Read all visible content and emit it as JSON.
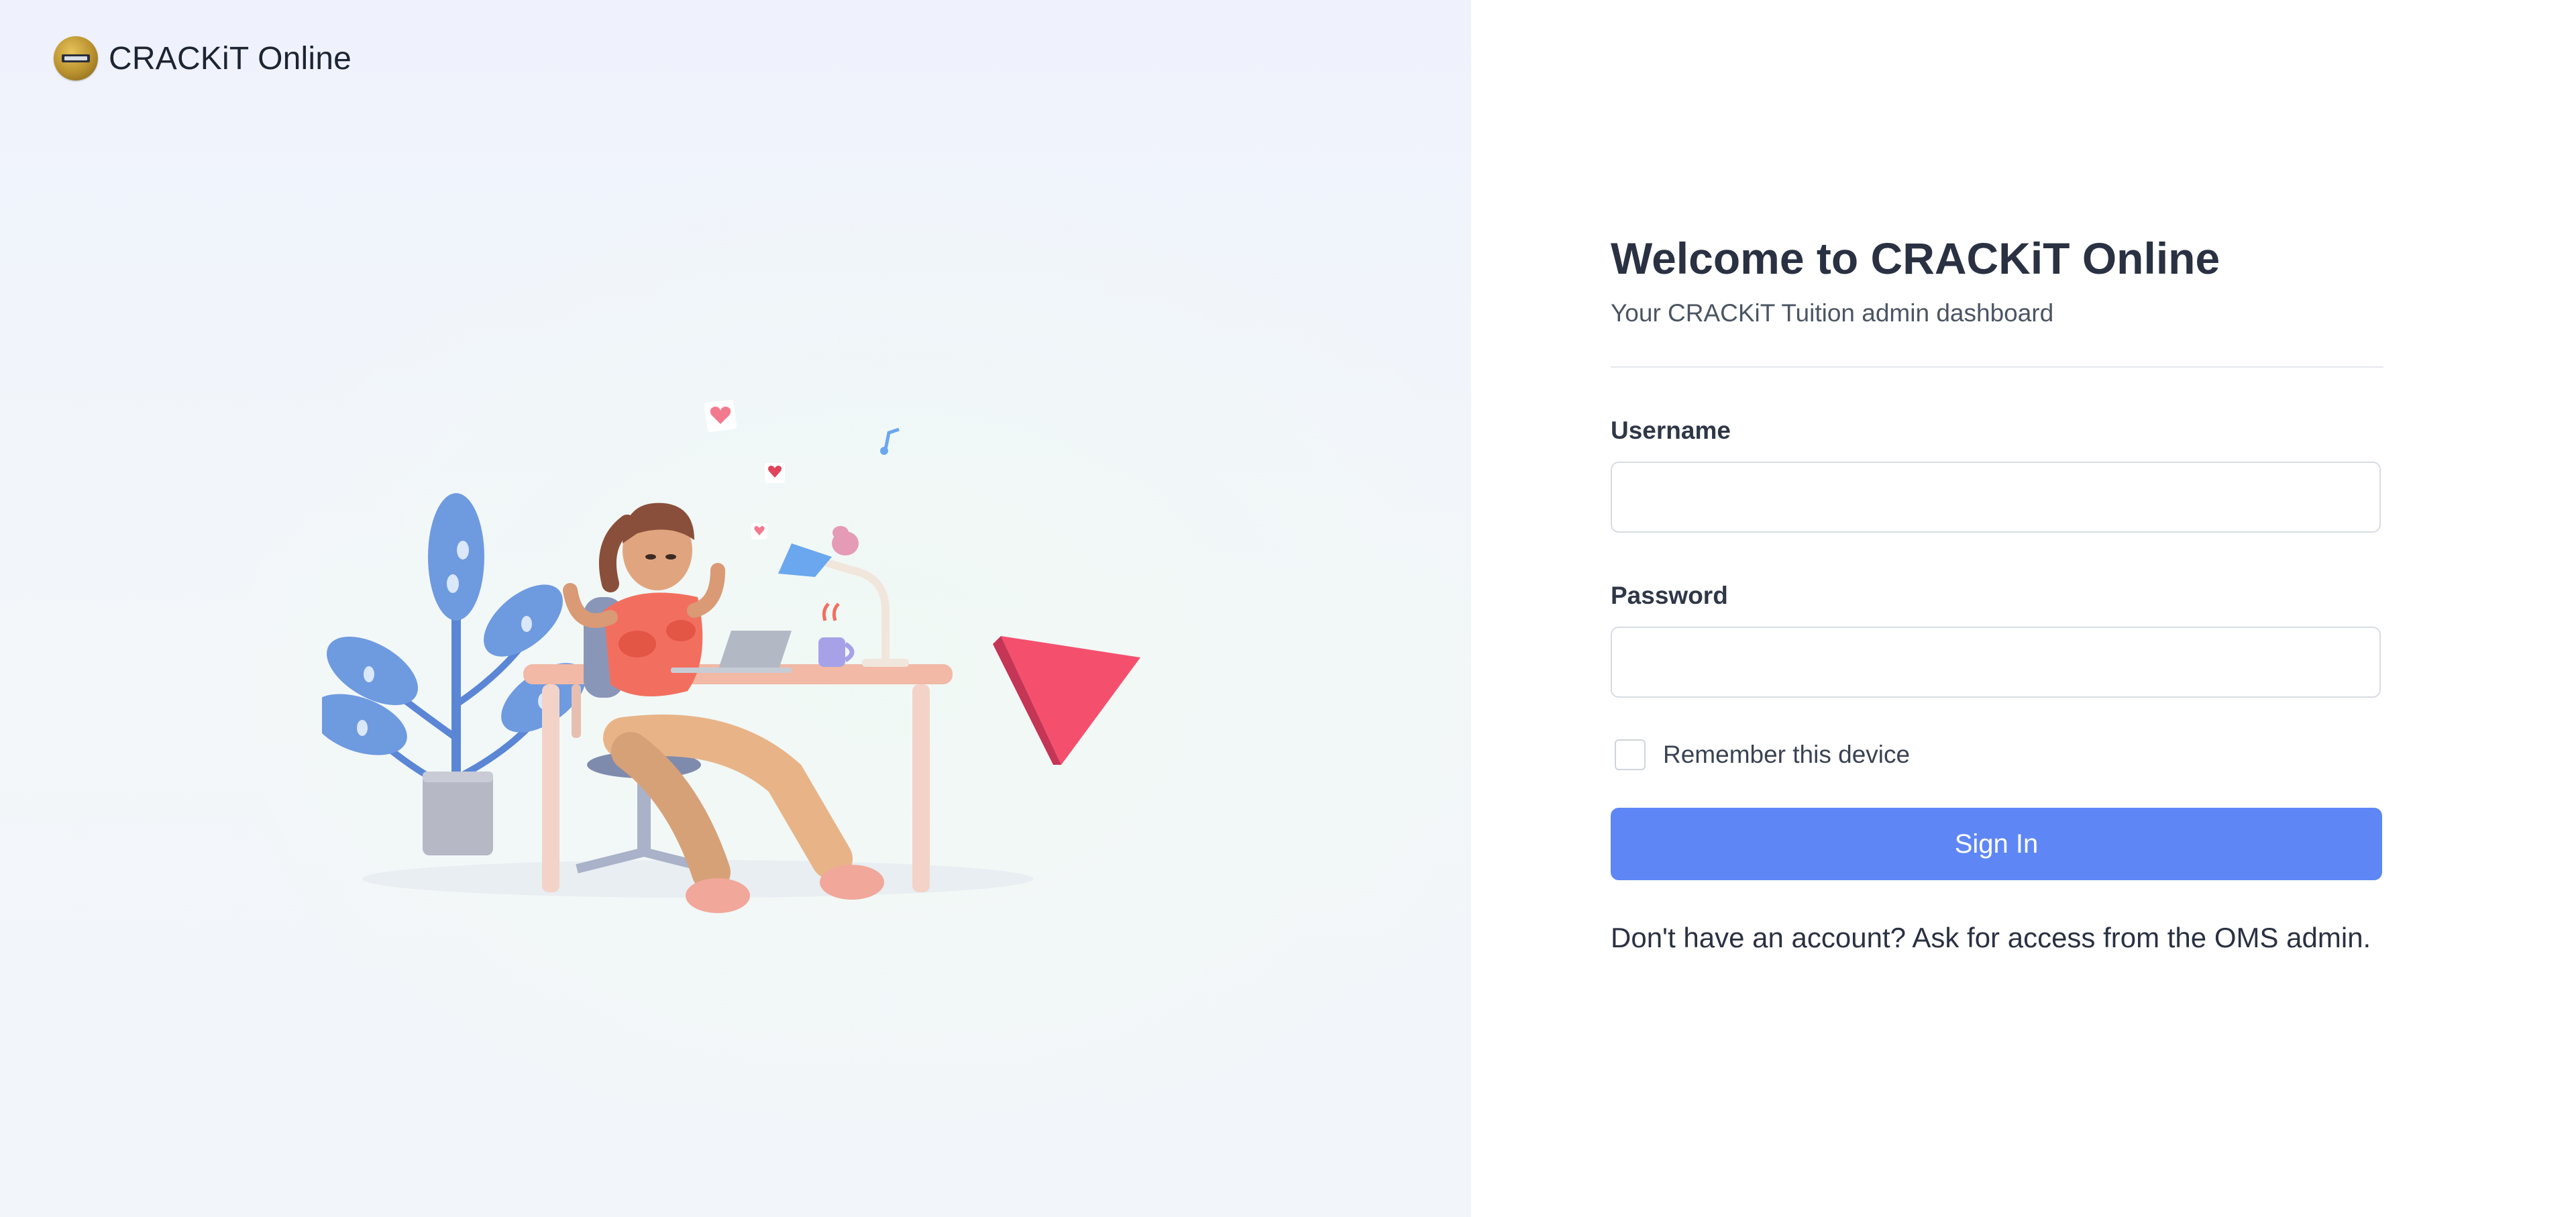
{
  "brand": {
    "name": "CRACKiT Online",
    "logo_icon": "crackit-logo-icon"
  },
  "form": {
    "title": "Welcome to CRACKiT Online",
    "subtitle": "Your CRACKiT Tuition admin dashboard",
    "username_label": "Username",
    "username_value": "",
    "password_label": "Password",
    "password_value": "",
    "remember_label": "Remember this device",
    "remember_checked": false,
    "signin_label": "Sign In",
    "footer_text": "Don't have an account? Ask for access from the OMS admin."
  },
  "colors": {
    "primary": "#5e87f5",
    "left_panel_bg": "#f1f4fa",
    "title_text": "#2a3142"
  }
}
